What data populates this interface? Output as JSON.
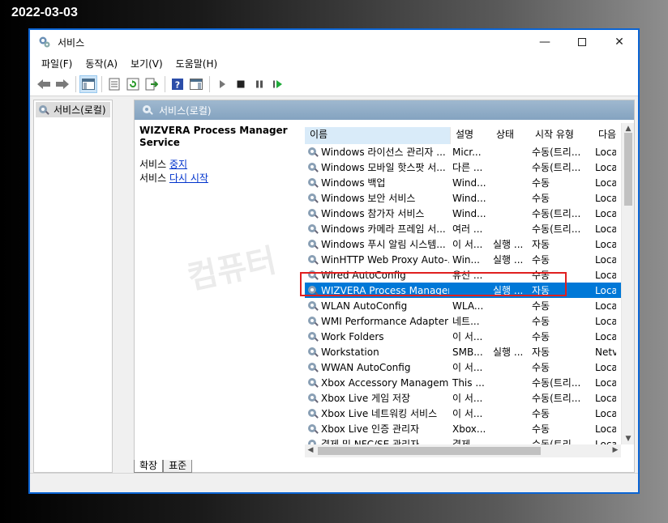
{
  "date_stamp": "2022-03-03",
  "watermark": "컴퓨터",
  "window": {
    "title": "서비스",
    "minimize_icon": "minimize-icon",
    "maximize_icon": "maximize-icon",
    "close_icon": "close-icon"
  },
  "menu": [
    "파일(F)",
    "동작(A)",
    "보기(V)",
    "도움말(H)"
  ],
  "tree": {
    "root_label": "서비스(로컬)"
  },
  "content_header": "서비스(로컬)",
  "detail": {
    "service_title": "WIZVERA Process Manager Service",
    "action1_prefix": "서비스",
    "action1_link": "중지",
    "action2_prefix": "서비스",
    "action2_link": "다시 시작"
  },
  "columns": {
    "name": "이름",
    "desc": "설명",
    "status": "상태",
    "start": "시작 유형",
    "logon": "다음"
  },
  "rows": [
    {
      "name": "Windows 라이선스 관리자 ...",
      "desc": "Micr...",
      "status": "",
      "start": "수동(트리...",
      "logon": "Loca"
    },
    {
      "name": "Windows 모바일 핫스팟 서...",
      "desc": "다른 ...",
      "status": "",
      "start": "수동(트리...",
      "logon": "Loca"
    },
    {
      "name": "Windows 백업",
      "desc": "Wind...",
      "status": "",
      "start": "수동",
      "logon": "Loca"
    },
    {
      "name": "Windows 보안 서비스",
      "desc": "Wind...",
      "status": "",
      "start": "수동",
      "logon": "Loca"
    },
    {
      "name": "Windows 참가자 서비스",
      "desc": "Wind...",
      "status": "",
      "start": "수동(트리...",
      "logon": "Loca"
    },
    {
      "name": "Windows 카메라 프레임 서...",
      "desc": "여러 ...",
      "status": "",
      "start": "수동(트리...",
      "logon": "Loca"
    },
    {
      "name": "Windows 푸시 알림 시스템...",
      "desc": "이 서...",
      "status": "실행 ...",
      "start": "자동",
      "logon": "Loca"
    },
    {
      "name": "WinHTTP Web Proxy Auto-...",
      "desc": "Win...",
      "status": "실행 ...",
      "start": "수동",
      "logon": "Loca"
    },
    {
      "name": "Wired AutoConfig",
      "desc": "유선 ...",
      "status": "",
      "start": "수동",
      "logon": "Loca"
    },
    {
      "name": "WIZVERA Process Manager...",
      "desc": "",
      "status": "실행 ...",
      "start": "자동",
      "logon": "Loca",
      "selected": true
    },
    {
      "name": "WLAN AutoConfig",
      "desc": "WLA...",
      "status": "",
      "start": "수동",
      "logon": "Loca"
    },
    {
      "name": "WMI Performance Adapter",
      "desc": "네트...",
      "status": "",
      "start": "수동",
      "logon": "Loca"
    },
    {
      "name": "Work Folders",
      "desc": "이 서...",
      "status": "",
      "start": "수동",
      "logon": "Loca"
    },
    {
      "name": "Workstation",
      "desc": "SMB...",
      "status": "실행 ...",
      "start": "자동",
      "logon": "Netv"
    },
    {
      "name": "WWAN AutoConfig",
      "desc": "이 서...",
      "status": "",
      "start": "수동",
      "logon": "Loca"
    },
    {
      "name": "Xbox Accessory Managem...",
      "desc": "This ...",
      "status": "",
      "start": "수동(트리...",
      "logon": "Loca"
    },
    {
      "name": "Xbox Live 게임 저장",
      "desc": "이 서...",
      "status": "",
      "start": "수동(트리...",
      "logon": "Loca"
    },
    {
      "name": "Xbox Live 네트워킹 서비스",
      "desc": "이 서...",
      "status": "",
      "start": "수동",
      "logon": "Loca"
    },
    {
      "name": "Xbox Live 인증 관리자",
      "desc": "Xbox...",
      "status": "",
      "start": "수동",
      "logon": "Loca"
    },
    {
      "name": "결제 및 NFC/SE 관리자",
      "desc": "결제 ...",
      "status": "",
      "start": "수동(트리...",
      "logon": "Loca"
    }
  ],
  "tabs": [
    "확장",
    "표준"
  ],
  "colors": {
    "titlebar_border": "#0a64d4",
    "selection": "#0078d7",
    "highlight_box": "#e02020"
  }
}
